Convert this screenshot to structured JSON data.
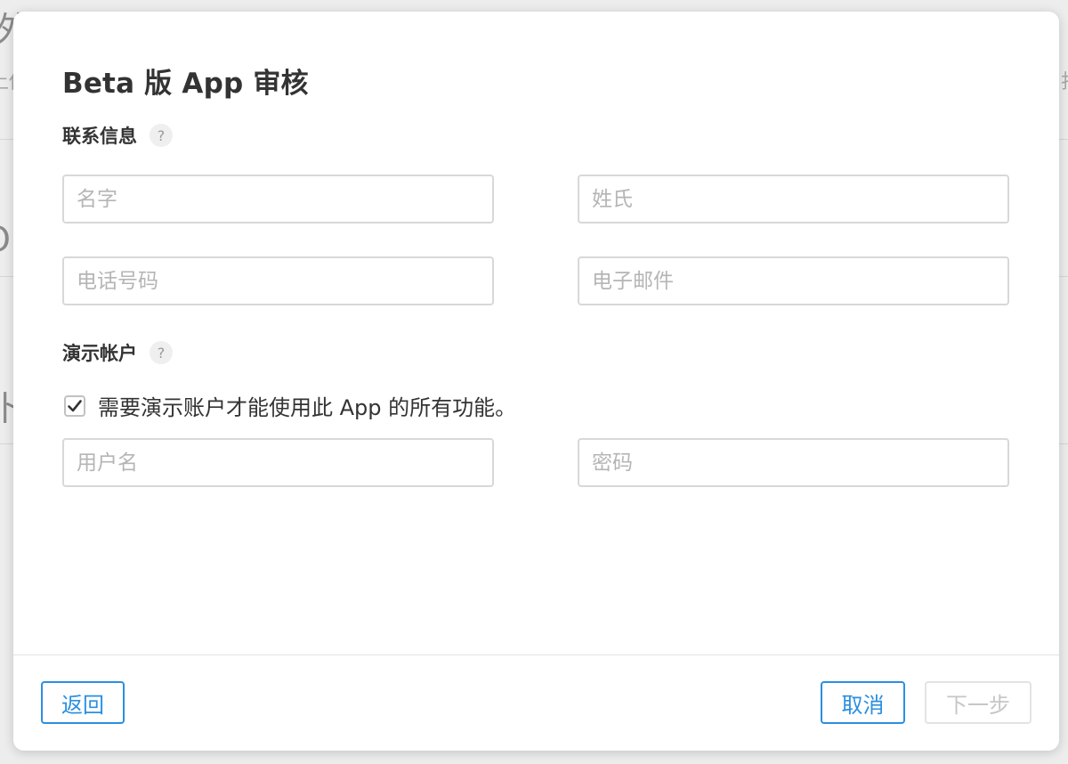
{
  "background": {
    "glyphs": [
      "外",
      "上传",
      "O",
      "卜",
      "打"
    ]
  },
  "modal": {
    "title": "Beta 版 App 审核",
    "contact_section": {
      "label": "联系信息",
      "help_icon": "question-mark-icon",
      "fields": {
        "first_name_placeholder": "名字",
        "last_name_placeholder": "姓氏",
        "phone_placeholder": "电话号码",
        "email_placeholder": "电子邮件"
      }
    },
    "demo_section": {
      "label": "演示帐户",
      "help_icon": "question-mark-icon",
      "checkbox_label": "需要演示账户才能使用此 App 的所有功能。",
      "checkbox_checked": true,
      "fields": {
        "username_placeholder": "用户名",
        "password_placeholder": "密码"
      }
    },
    "footer": {
      "back_label": "返回",
      "cancel_label": "取消",
      "next_label": "下一步",
      "next_disabled": true
    }
  },
  "colors": {
    "accent": "#2a8fe0",
    "text": "#333333",
    "placeholder": "#b5b5b5",
    "border": "#d8d8d8",
    "disabled": "#c6c6c6"
  }
}
